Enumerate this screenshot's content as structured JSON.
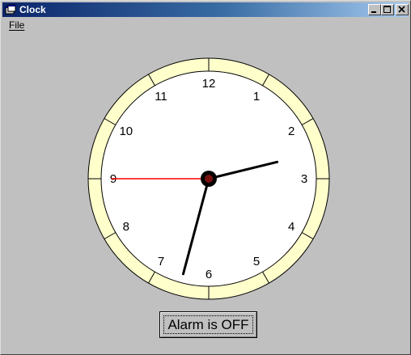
{
  "window": {
    "title": "Clock",
    "title_bar_color": "#0a246a",
    "background_color": "#c0c0c0"
  },
  "menu": {
    "items": [
      {
        "label": "File"
      }
    ]
  },
  "clock": {
    "numerals": [
      "12",
      "1",
      "2",
      "3",
      "4",
      "5",
      "6",
      "7",
      "8",
      "9",
      "10",
      "11"
    ],
    "time": {
      "hours": 2,
      "minutes": 32.5,
      "seconds": 45
    },
    "bezel_color": "#ffffcc",
    "face_color": "#ffffff",
    "second_hand_color": "#ff0000",
    "hand_color": "#000000"
  },
  "alarm": {
    "button_label": "Alarm is OFF"
  }
}
